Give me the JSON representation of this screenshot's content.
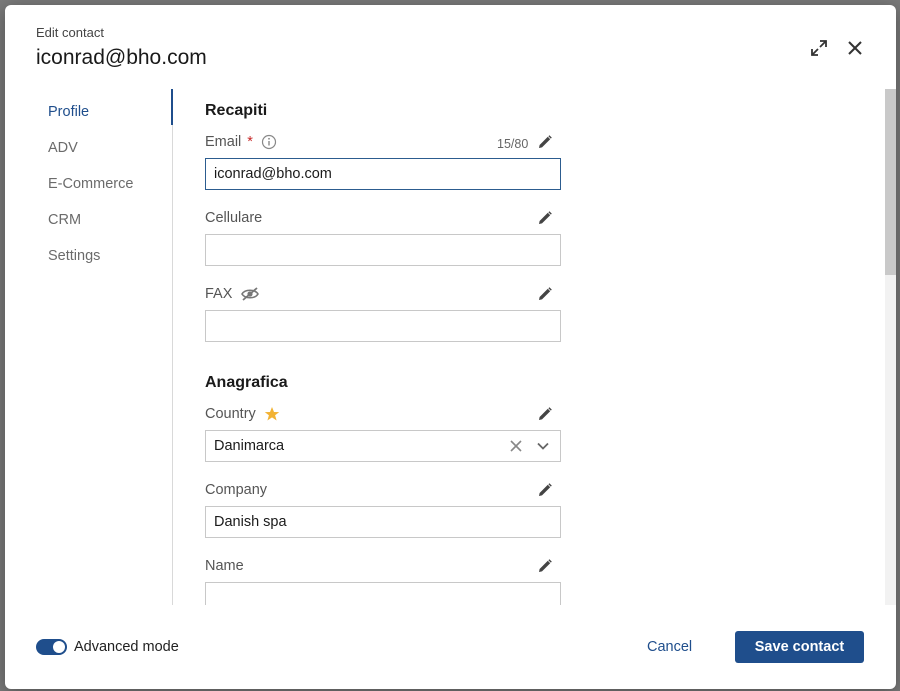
{
  "modal": {
    "subtitle": "Edit contact",
    "title": "iconrad@bho.com"
  },
  "header_icons": [
    "expand-icon",
    "close-icon"
  ],
  "sidebar": {
    "items": [
      {
        "label": "Profile",
        "active": true
      },
      {
        "label": "ADV"
      },
      {
        "label": "E-Commerce"
      },
      {
        "label": "CRM"
      },
      {
        "label": "Settings"
      }
    ]
  },
  "sections": {
    "recapiti": "Recapiti",
    "anagrafica": "Anagrafica"
  },
  "fields": {
    "email": {
      "label": "Email",
      "required_mark": "*",
      "counter": "15/80",
      "value": "iconrad@bho.com"
    },
    "cellulare": {
      "label": "Cellulare",
      "value": ""
    },
    "fax": {
      "label": "FAX",
      "value": ""
    },
    "country": {
      "label": "Country",
      "value": "Danimarca"
    },
    "company": {
      "label": "Company",
      "value": "Danish spa"
    },
    "name": {
      "label": "Name",
      "value": ""
    }
  },
  "footer": {
    "toggle_label": "Advanced mode",
    "toggle_on": true,
    "cancel_label": "Cancel",
    "save_label": "Save contact"
  },
  "colors": {
    "accent": "#1f4e8c",
    "required": "#c62828",
    "star": "#f2b233"
  }
}
